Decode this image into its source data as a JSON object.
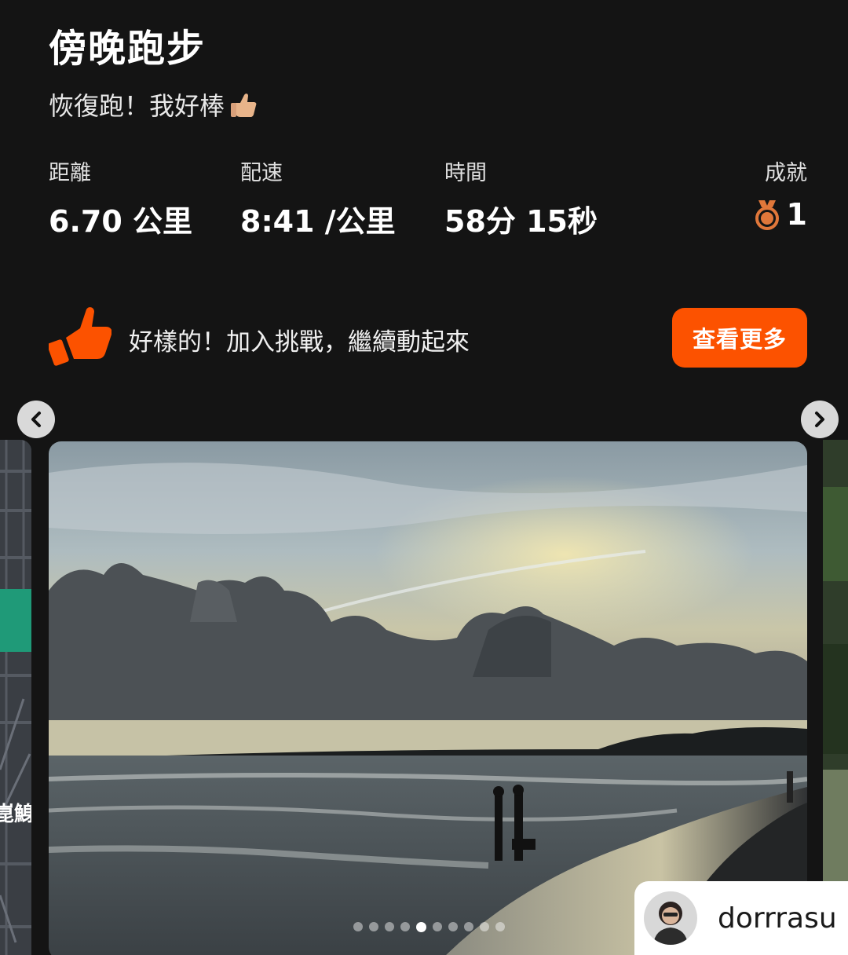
{
  "activity": {
    "title": "傍晚跑步",
    "description": "恢復跑！我好棒",
    "description_emoji": "thumbs-up-emoji"
  },
  "stats": [
    {
      "label": "距離",
      "value": "6.70 公里"
    },
    {
      "label": "配速",
      "value": "8:41 /公里"
    },
    {
      "label": "時間",
      "value": "58分 15秒"
    },
    {
      "label": "成就",
      "value": "1",
      "icon": "medal-icon"
    }
  ],
  "promo": {
    "text": "好樣的！加入挑戰，繼續動起來",
    "button_label": "查看更多",
    "icon": "thumbs-up-icon"
  },
  "carousel": {
    "total_slides": 10,
    "active_index": 4,
    "map_label_fragment": "崑鯓"
  },
  "author": {
    "username": "dorrrasu"
  },
  "colors": {
    "background": "#141414",
    "accent": "#fc5200",
    "medal": "#e0773a"
  }
}
